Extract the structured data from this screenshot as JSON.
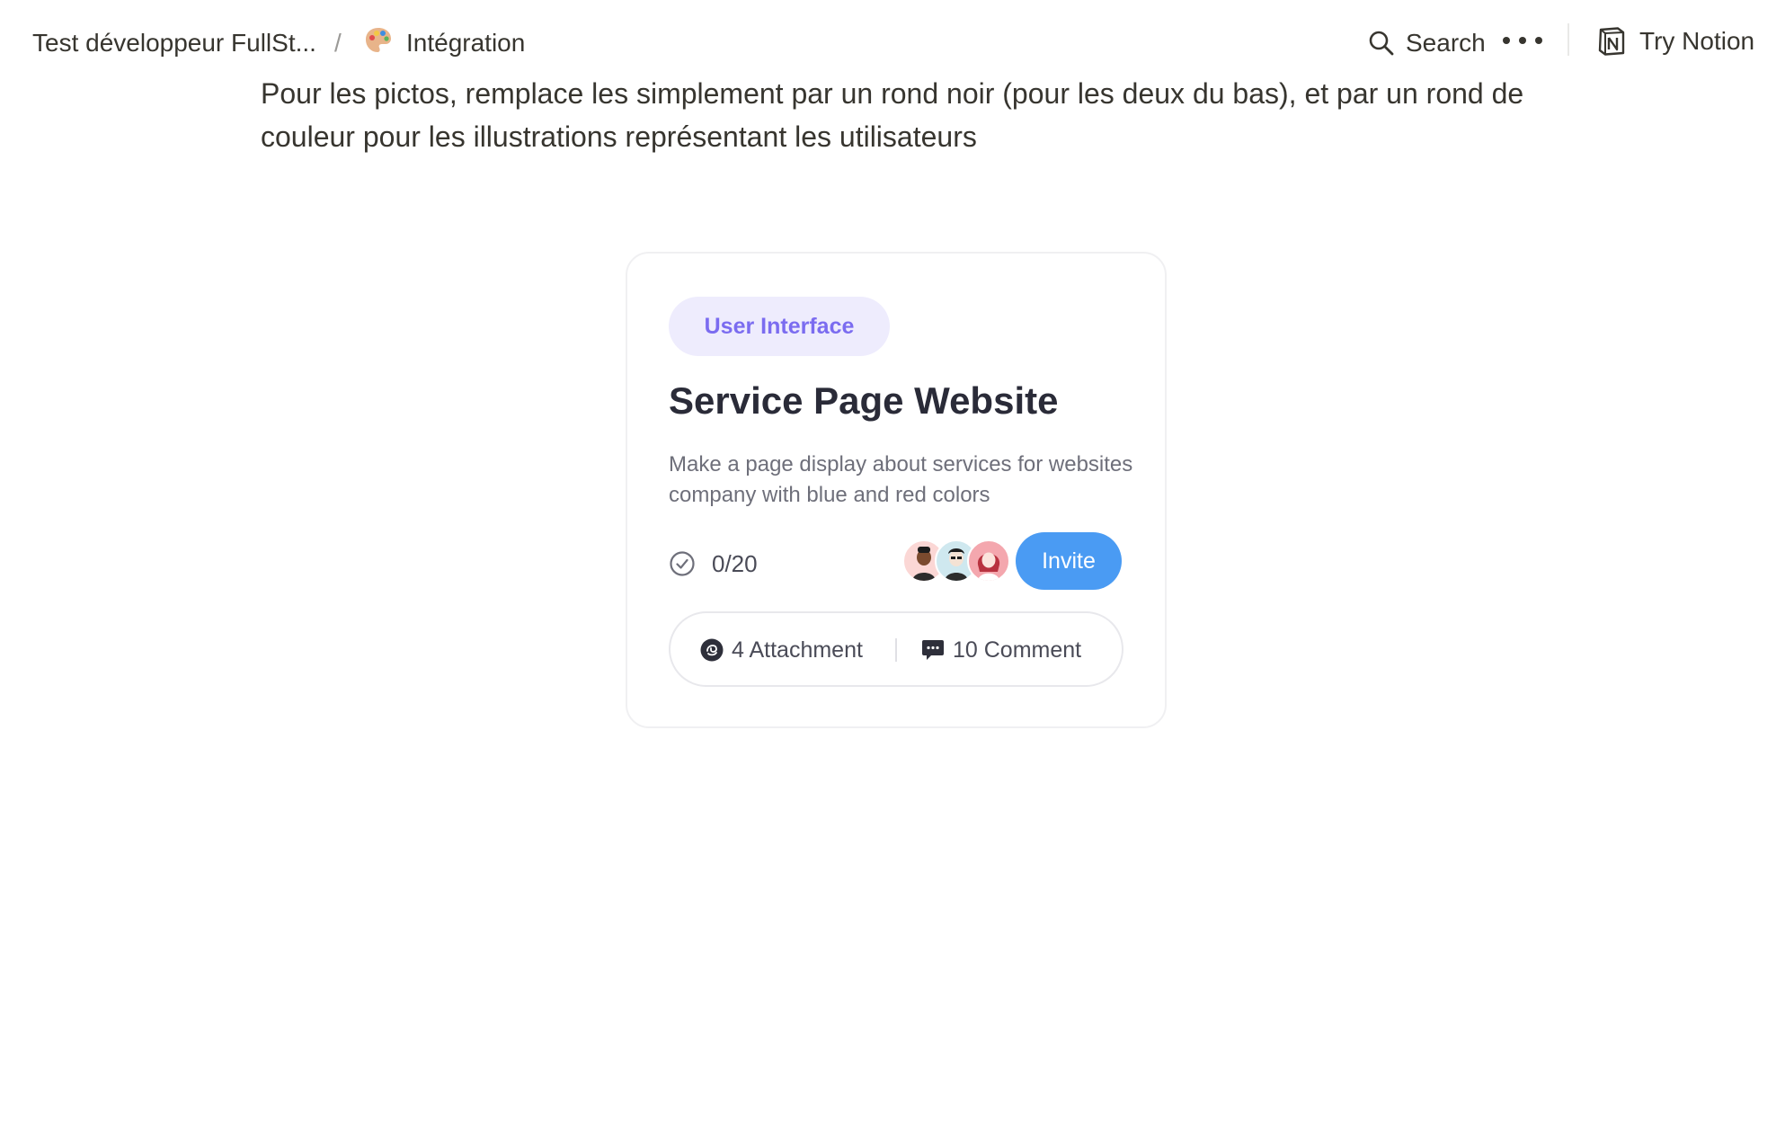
{
  "topbar": {
    "breadcrumb": {
      "parent": "Test développeur FullSt...",
      "separator": "/",
      "current": "Intégration",
      "current_icon": "palette-icon"
    },
    "search_label": "Search",
    "more_icon": "ellipsis-icon",
    "try_notion_label": "Try Notion",
    "notion_icon": "notion-logo-icon"
  },
  "content": {
    "paragraph": "Pour les pictos, remplace les simplement par un rond noir (pour les deux du bas), et par un rond de couleur pour les illustrations représentant les utilisateurs"
  },
  "card": {
    "tag": "User Interface",
    "title": "Service Page Website",
    "description": "Make a page display about services for websites company with blue and red colors",
    "progress": "0/20",
    "invite_label": "Invite",
    "attachment_label": "4 Attachment",
    "comment_label": "10 Comment",
    "colors": {
      "tag_bg": "#eeecfd",
      "tag_text": "#7b6cf0",
      "invite_bg": "#4a9bf3"
    }
  }
}
